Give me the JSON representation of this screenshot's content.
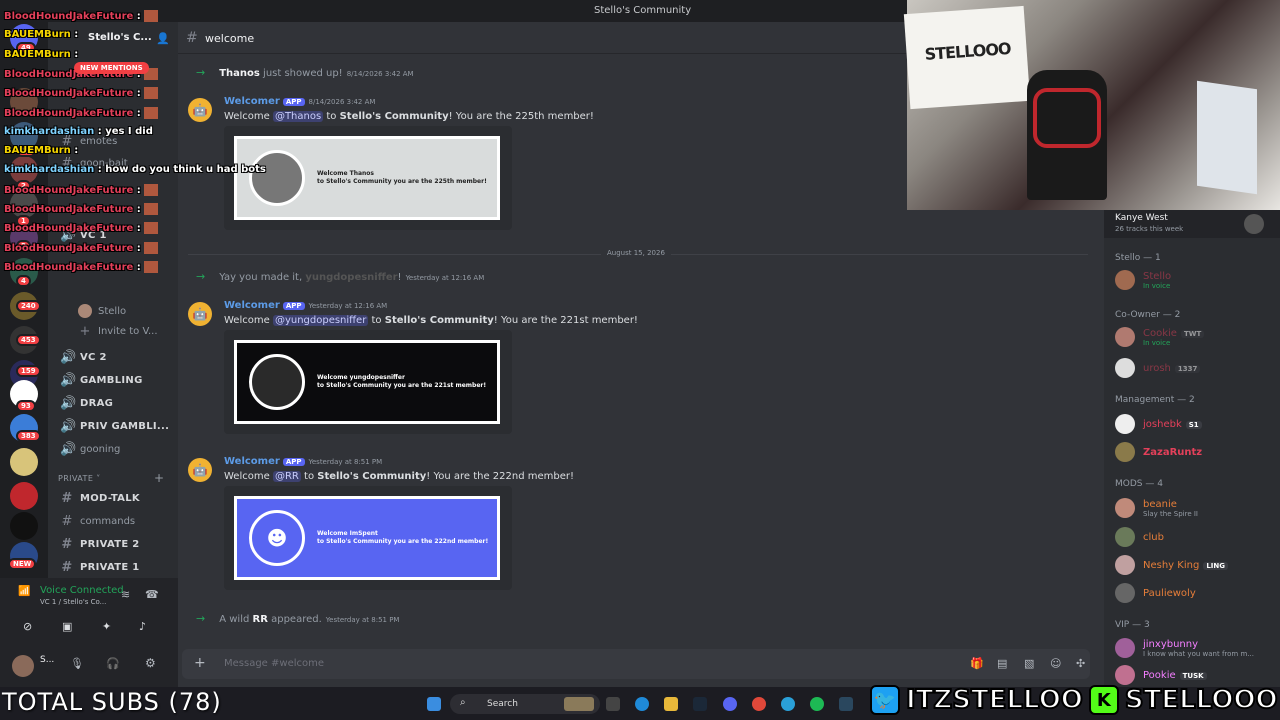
{
  "window": {
    "title": "Stello's Community"
  },
  "server": {
    "name": "Stello's C...",
    "new_mentions": "NEW MENTIONS"
  },
  "guild_badges": [
    "49",
    "17",
    "2",
    "1",
    "3",
    "4",
    "240",
    "453",
    "159",
    "93",
    "383",
    "NEW"
  ],
  "channels": {
    "items": [
      {
        "label": "emotes",
        "type": "text"
      },
      {
        "label": "goon-bait",
        "type": "text"
      },
      {
        "label": "VC 1",
        "type": "voice"
      },
      {
        "label": "VC 2",
        "type": "voice"
      },
      {
        "label": "GAMBLING",
        "type": "voice"
      },
      {
        "label": "DRAG",
        "type": "voice"
      },
      {
        "label": "PRIV GAMBLI...",
        "type": "voice"
      },
      {
        "label": "gooning",
        "type": "voice"
      }
    ],
    "vc_users": [
      "Stello",
      "Invite to V..."
    ],
    "private_category": "PRIVATE",
    "private_items": [
      "MOD-TALK",
      "commands",
      "PRIVATE 2",
      "PRIVATE 1"
    ]
  },
  "voice": {
    "status": "Voice Connected",
    "location": "VC 1 / Stello's Co..."
  },
  "user": {
    "name": "S..."
  },
  "channel_header": {
    "name": "welcome"
  },
  "messages": {
    "join1": {
      "user": "Thanos",
      "text": "just showed up!",
      "time": "8/14/2026 3:42 AM"
    },
    "m1": {
      "author": "Welcomer",
      "app": "APP",
      "time": "8/14/2026 3:42 AM",
      "pre": "Welcome",
      "mention": "@Thanos",
      "to": "to",
      "server": "Stello's Community",
      "rest": "! You are the 225th member!",
      "card1": "Welcome Thanos",
      "card2": "to Stello's Community you are the 225th member!"
    },
    "date_divider": "August 15, 2026",
    "join2": {
      "text": "Yay you made it,",
      "user": "yungdopesniffer",
      "end": "!",
      "time": "Yesterday at 12:16 AM"
    },
    "m2": {
      "author": "Welcomer",
      "app": "APP",
      "time": "Yesterday at 12:16 AM",
      "pre": "Welcome",
      "mention": "@yungdopesniffer",
      "to": "to",
      "server": "Stello's Community",
      "rest": "! You are the 221st member!",
      "card1": "Welcome yungdopesniffer",
      "card2": "to Stello's Community you are the 221st member!"
    },
    "m3": {
      "author": "Welcomer",
      "app": "APP",
      "time": "Yesterday at 8:51 PM",
      "pre": "Welcome",
      "mention": "@RR",
      "to": "to",
      "server": "Stello's Community",
      "rest": "! You are the 222nd member!",
      "card1": "Welcome ImSpent",
      "card2": "to Stello's Community you are the 222nd member!"
    },
    "join3": {
      "pre": "A wild",
      "user": "RR",
      "end": "appeared.",
      "time": "Yesterday at 8:51 PM"
    }
  },
  "composer": {
    "placeholder": "Message #welcome"
  },
  "now_playing": {
    "artist": "Kanye West",
    "info": "26 tracks this week"
  },
  "members": {
    "stello_cat": "Stello — 1",
    "stello_members": [
      {
        "name": "Stello",
        "sub": "In voice",
        "color": "#e3405a"
      }
    ],
    "coowner_cat": "Co-Owner — 2",
    "coowner_members": [
      {
        "name": "Cookie",
        "tag": "TWT",
        "sub": "In voice",
        "color": "#e3405a"
      },
      {
        "name": "urosh",
        "tag": "1337",
        "sub": "",
        "color": "#e3405a"
      }
    ],
    "mgmt_cat": "Management — 2",
    "mgmt_members": [
      {
        "name": "joshebk",
        "tag": "S1",
        "color": "#e3405a"
      },
      {
        "name": "ZazaRuntz",
        "tag": "",
        "color": "#e3405a"
      }
    ],
    "mods_cat": "MODS — 4",
    "mods_members": [
      {
        "name": "beanie",
        "sub": "Slay the Spire II",
        "color": "#e67e3a"
      },
      {
        "name": "club",
        "sub": "",
        "color": "#e67e3a"
      },
      {
        "name": "Neshy King",
        "tag": "LING",
        "sub": "",
        "color": "#e67e3a"
      },
      {
        "name": "Pauliewoly",
        "sub": "",
        "color": "#e67e3a"
      }
    ],
    "vip_cat": "VIP — 3",
    "vip_members": [
      {
        "name": "jinxybunny",
        "sub": "I know what you want from m...",
        "color": "#f47fff"
      },
      {
        "name": "Pookie",
        "tag": "TUSK",
        "sub": "",
        "color": "#f47fff"
      }
    ]
  },
  "chat_overlay": [
    {
      "user": "BloodHoundJakeFuture",
      "msg": ":",
      "emote": true,
      "c": ""
    },
    {
      "user": "BAUEMBurn",
      "msg": ":",
      "emote": false,
      "c": "y"
    },
    {
      "user": "BAUEMBurn",
      "msg": ":",
      "emote": false,
      "c": "y"
    },
    {
      "user": "BloodHoundJakeFuture",
      "msg": ":",
      "emote": true,
      "c": ""
    },
    {
      "user": "BloodHoundJakeFuture",
      "msg": ":",
      "emote": true,
      "c": ""
    },
    {
      "user": "BloodHoundJakeFuture",
      "msg": ":",
      "emote": true,
      "c": ""
    },
    {
      "user": "kimkhardashian",
      "msg": ": yes I did",
      "emote": false,
      "c": "b"
    },
    {
      "user": "BAUEMBurn",
      "msg": ":",
      "emote": false,
      "c": "y"
    },
    {
      "user": "kimkhardashian",
      "msg": ": how do you think u had bots",
      "emote": false,
      "c": "b"
    },
    {
      "user": "BloodHoundJakeFuture",
      "msg": ":",
      "emote": true,
      "c": ""
    },
    {
      "user": "BloodHoundJakeFuture",
      "msg": ":",
      "emote": true,
      "c": ""
    },
    {
      "user": "BloodHoundJakeFuture",
      "msg": ":",
      "emote": true,
      "c": ""
    },
    {
      "user": "BloodHoundJakeFuture",
      "msg": ":",
      "emote": true,
      "c": ""
    },
    {
      "user": "BloodHoundJakeFuture",
      "msg": ":",
      "emote": true,
      "c": ""
    }
  ],
  "taskbar": {
    "search": "Search"
  },
  "overlay": {
    "subs": "TOTAL SUBS (78)",
    "twitter": "ITZSTELLOO",
    "kick": "STELLOOO"
  },
  "colors": {
    "accent": "#5865f2",
    "online": "#23a55a",
    "danger": "#f23f43"
  }
}
